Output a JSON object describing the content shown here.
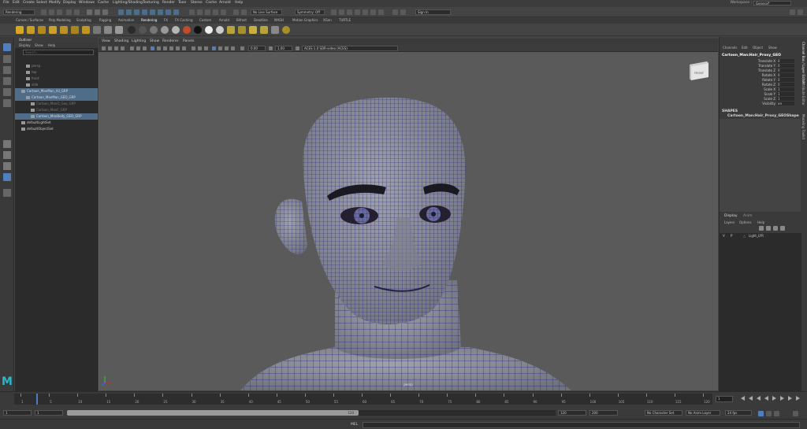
{
  "menubar": {
    "items": [
      "File",
      "Edit",
      "Create",
      "Select",
      "Modify",
      "Display",
      "Windows",
      "Cache",
      "Lighting/Shading",
      "Texturing",
      "Render",
      "Toon",
      "Stereo",
      "Cache",
      "Arnold",
      "Help"
    ],
    "workspace_label": "Workspace :",
    "workspace_value": "General*"
  },
  "statusline": {
    "menuset": "Rendering",
    "live_surface": "No Live Surface",
    "symmetry": "Symmetry: Off",
    "signin": "Sign In"
  },
  "shelf": {
    "tabs": [
      "Curves / Surfaces",
      "Poly Modeling",
      "Sculpting",
      "Rigging",
      "Animation",
      "Rendering",
      "FX",
      "FX Caching",
      "Custom",
      "Arnold",
      "Bifrost",
      "Deadline",
      "MASH",
      "Motion Graphics",
      "XGen",
      "TURTLE"
    ]
  },
  "outliner": {
    "title": "Outliner",
    "menu": [
      "Display",
      "Show",
      "Help"
    ],
    "search_placeholder": "Search...",
    "rows": [
      {
        "label": "persp",
        "color": "#8a8a8a",
        "indent": 14
      },
      {
        "label": "top",
        "color": "#8a8a8a",
        "indent": 14
      },
      {
        "label": "front",
        "color": "#8a8a8a",
        "indent": 14
      },
      {
        "label": "side",
        "color": "#8a8a8a",
        "indent": 14
      },
      {
        "label": "Cartoon_ManMan_All_GRP",
        "color": "#dddddd",
        "indent": 8,
        "selected": true
      },
      {
        "label": "Cartoon_ManMan_GEO_GRP",
        "color": "#dddddd",
        "indent": 14,
        "selected": true
      },
      {
        "label": "Cartoon_ManO_Geo_GRP",
        "color": "#7a7a7a",
        "indent": 20
      },
      {
        "label": "Cartoon_ManF_GRP",
        "color": "#7a7a7a",
        "indent": 20
      },
      {
        "label": "Cartoon_ManBody_GEO_GRP",
        "color": "#dddddd",
        "indent": 20,
        "selected": true
      },
      {
        "label": "defaultLightSet",
        "color": "#cccccc",
        "indent": 8
      },
      {
        "label": "defaultObjectSet",
        "color": "#cccccc",
        "indent": 8
      }
    ]
  },
  "viewport": {
    "menu": [
      "View",
      "Shading",
      "Lighting",
      "Show",
      "Renderer",
      "Panels"
    ],
    "value_a": "0.00",
    "value_b": "1.00",
    "colorspace": "ACES 1.0 SDR-video (ACES)",
    "viewcube_label": "FRONT",
    "camera_label": "persp"
  },
  "channelbox": {
    "menu": [
      "Channels",
      "Edit",
      "Object",
      "Show"
    ],
    "object_name": "Cartoon_Man:Hair_Proxy_GEO",
    "attributes": [
      {
        "name": "Translate X",
        "value": "0"
      },
      {
        "name": "Translate Y",
        "value": "0"
      },
      {
        "name": "Translate Z",
        "value": "0"
      },
      {
        "name": "Rotate X",
        "value": "0"
      },
      {
        "name": "Rotate Y",
        "value": "0"
      },
      {
        "name": "Rotate Z",
        "value": "0"
      },
      {
        "name": "Scale X",
        "value": "1"
      },
      {
        "name": "Scale Y",
        "value": "1"
      },
      {
        "name": "Scale Z",
        "value": "1"
      },
      {
        "name": "Visibility",
        "value": "on"
      }
    ],
    "shapes_title": "SHAPES",
    "shape_name": "Cartoon_Man:Hair_Proxy_GEOShape"
  },
  "sidetabs": [
    "Channel Box / Layer Editor",
    "Attribute Editor",
    "Modeling Toolkit"
  ],
  "layer_editor": {
    "tabs": [
      "Display",
      "Anim"
    ],
    "menu": [
      "Layers",
      "Options",
      "Help"
    ],
    "layer": {
      "v": "V",
      "p": "P",
      "name": "Light_LYR"
    }
  },
  "timeslider": {
    "ticks": [
      "1",
      "5",
      "10",
      "15",
      "20",
      "25",
      "30",
      "35",
      "40",
      "45",
      "50",
      "55",
      "60",
      "65",
      "70",
      "75",
      "80",
      "85",
      "90",
      "95",
      "100",
      "105",
      "110",
      "115",
      "120"
    ],
    "current_frame": "1"
  },
  "rangeslider": {
    "start": "1",
    "inner_start": "1",
    "range_end_label": "120",
    "end": "120",
    "outer_end": "200",
    "character_set": "No Character Set",
    "anim_layer": "No Anim Layer",
    "fps": "24 fps"
  },
  "cmdline": {
    "label": "MEL"
  },
  "colors": {
    "accent": "#4a7cbf",
    "selection": "#4f6d89",
    "wire": "#1c1a86",
    "skin": "#8b8d97"
  }
}
